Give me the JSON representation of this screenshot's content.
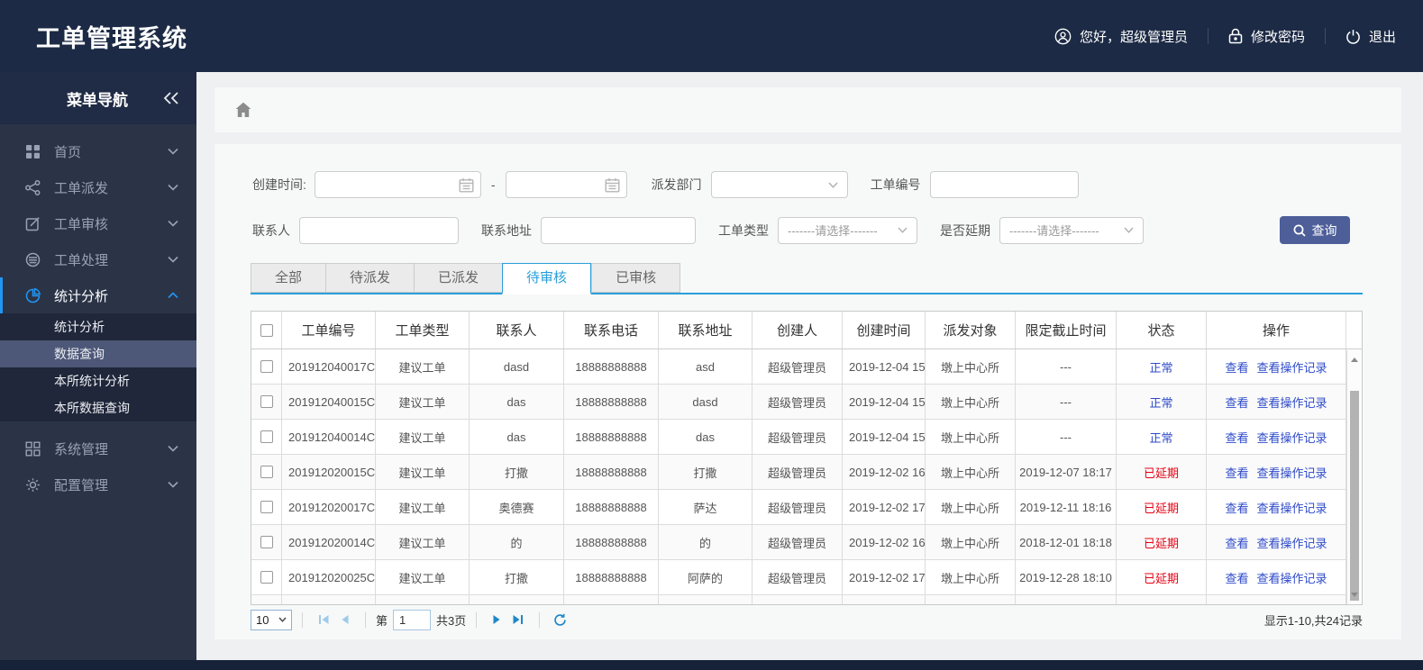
{
  "app": {
    "title": "工单管理系统"
  },
  "header": {
    "greeting": "您好，超级管理员",
    "change_password": "修改密码",
    "logout": "退出"
  },
  "sidebar": {
    "nav_title": "菜单导航",
    "items": [
      {
        "label": "首页",
        "icon": "grid-icon"
      },
      {
        "label": "工单派发",
        "icon": "share-icon"
      },
      {
        "label": "工单审核",
        "icon": "edit-icon"
      },
      {
        "label": "工单处理",
        "icon": "process-icon"
      },
      {
        "label": "统计分析",
        "icon": "pie-chart-icon",
        "active": true,
        "expanded": true,
        "children": [
          {
            "label": "统计分析"
          },
          {
            "label": "数据查询",
            "selected": true
          },
          {
            "label": "本所统计分析"
          },
          {
            "label": "本所数据查询"
          }
        ]
      },
      {
        "label": "系统管理",
        "icon": "grid-outline-icon"
      },
      {
        "label": "配置管理",
        "icon": "gear-icon"
      }
    ]
  },
  "filters": {
    "create_time_label": "创建时间:",
    "range_separator": "-",
    "dispatch_dept_label": "派发部门",
    "order_no_label": "工单编号",
    "contact_label": "联系人",
    "address_label": "联系地址",
    "order_type_label": "工单类型",
    "delayed_label": "是否延期",
    "select_placeholder": "-------请选择-------",
    "search_button": "查询"
  },
  "tabs": [
    {
      "label": "全部"
    },
    {
      "label": "待派发"
    },
    {
      "label": "已派发"
    },
    {
      "label": "待审核",
      "active": true
    },
    {
      "label": "已审核"
    }
  ],
  "table": {
    "columns": [
      "工单编号",
      "工单类型",
      "联系人",
      "联系电话",
      "联系地址",
      "创建人",
      "创建时间",
      "派发对象",
      "限定截止时间",
      "状态",
      "操作"
    ],
    "view_label": "查看",
    "view_log_label": "查看操作记录",
    "status_normal_color": "#2e4ac9",
    "status_delayed_color": "#e60012",
    "rows": [
      {
        "order_no": "201912040017C",
        "type": "建议工单",
        "contact": "dasd",
        "phone": "18888888888",
        "address": "asd",
        "creator": "超级管理员",
        "create_time": "2019-12-04 15:",
        "target": "墩上中心所",
        "deadline": "---",
        "status": "正常",
        "delayed": false
      },
      {
        "order_no": "201912040015C",
        "type": "建议工单",
        "contact": "das",
        "phone": "18888888888",
        "address": "dasd",
        "creator": "超级管理员",
        "create_time": "2019-12-04 15:",
        "target": "墩上中心所",
        "deadline": "---",
        "status": "正常",
        "delayed": false
      },
      {
        "order_no": "201912040014C",
        "type": "建议工单",
        "contact": "das",
        "phone": "18888888888",
        "address": "das",
        "creator": "超级管理员",
        "create_time": "2019-12-04 15:",
        "target": "墩上中心所",
        "deadline": "---",
        "status": "正常",
        "delayed": false
      },
      {
        "order_no": "201912020015C",
        "type": "建议工单",
        "contact": "打撒",
        "phone": "18888888888",
        "address": "打撒",
        "creator": "超级管理员",
        "create_time": "2019-12-02 16:",
        "target": "墩上中心所",
        "deadline": "2019-12-07 18:17",
        "status": "已延期",
        "delayed": true
      },
      {
        "order_no": "201912020017C",
        "type": "建议工单",
        "contact": "奥德赛",
        "phone": "18888888888",
        "address": "萨达",
        "creator": "超级管理员",
        "create_time": "2019-12-02 17:",
        "target": "墩上中心所",
        "deadline": "2019-12-11 18:16",
        "status": "已延期",
        "delayed": true
      },
      {
        "order_no": "201912020014C",
        "type": "建议工单",
        "contact": "的",
        "phone": "18888888888",
        "address": "的",
        "creator": "超级管理员",
        "create_time": "2019-12-02 16:",
        "target": "墩上中心所",
        "deadline": "2018-12-01 18:18",
        "status": "已延期",
        "delayed": true
      },
      {
        "order_no": "201912020025C",
        "type": "建议工单",
        "contact": "打撒",
        "phone": "18888888888",
        "address": "阿萨的",
        "creator": "超级管理员",
        "create_time": "2019-12-02 17:",
        "target": "墩上中心所",
        "deadline": "2019-12-28 18:10",
        "status": "已延期",
        "delayed": true
      },
      {
        "order_no": "",
        "type": "",
        "contact": "",
        "phone": "",
        "address": "",
        "creator": "",
        "create_time": "",
        "target": "",
        "deadline": "",
        "status": "",
        "delayed": false,
        "partial": true
      }
    ]
  },
  "pagination": {
    "page_size": "10",
    "page_prefix": "第",
    "current_page": "1",
    "total_pages": "共3页",
    "record_info": "显示1-10,共24记录"
  },
  "colors": {
    "header_bg": "#1c2a45",
    "sidebar_bg": "#2b3447",
    "accent_blue": "#2196f3",
    "tab_blue": "#2a9fd9",
    "link_blue": "#2e4ac9",
    "status_red": "#e60012",
    "search_button_bg": "#4d5e99"
  }
}
